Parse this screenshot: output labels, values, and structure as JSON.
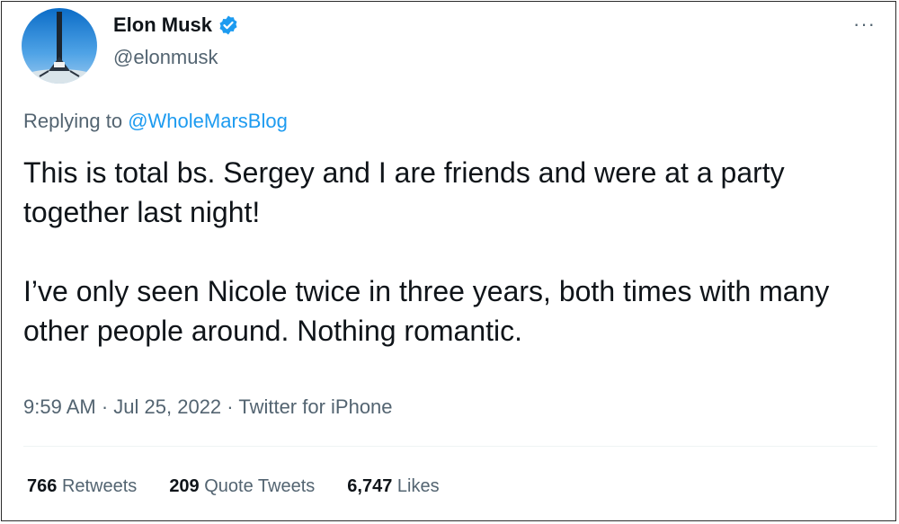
{
  "tweet": {
    "author": {
      "display_name": "Elon Musk",
      "handle": "@elonmusk",
      "verified": true,
      "avatar_icon": "rocket-launch-avatar"
    },
    "more_icon": "···",
    "reply": {
      "prefix": "Replying to",
      "handle": "@WholeMarsBlog"
    },
    "paragraphs": [
      "This is total bs. Sergey and I are friends and were at a party together last night!",
      "I’ve only seen Nicole twice in three years, both times with many other people around. Nothing romantic."
    ],
    "meta": {
      "time": "9:59 AM",
      "separator": "·",
      "date": "Jul 25, 2022",
      "source": "Twitter for iPhone"
    },
    "stats": [
      {
        "count": "766",
        "label": "Retweets"
      },
      {
        "count": "209",
        "label": "Quote Tweets"
      },
      {
        "count": "6,747",
        "label": "Likes"
      }
    ]
  },
  "colors": {
    "text": "#0f1419",
    "secondary": "#536471",
    "accent": "#1d9bf0"
  }
}
